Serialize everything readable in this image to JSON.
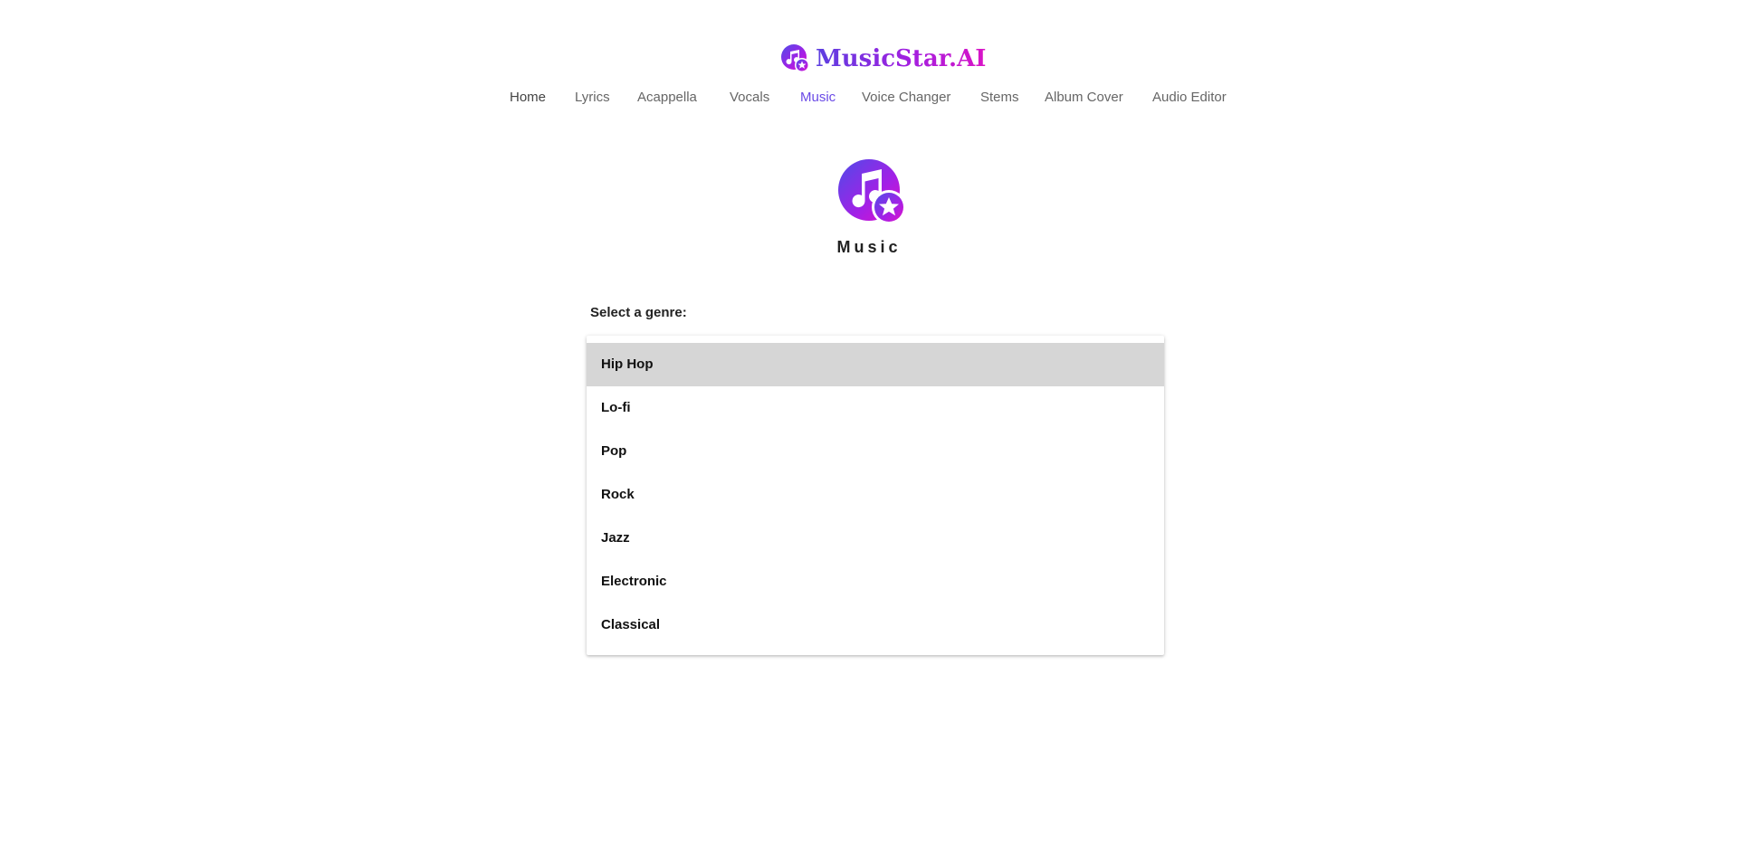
{
  "brand": {
    "name": "MusicStar.AI",
    "colors": {
      "gradient_start": "#5b3fe0",
      "gradient_end": "#d914c6",
      "nav_active": "#6a4ae6"
    },
    "icon": "music-note-star-icon"
  },
  "nav": {
    "items": [
      {
        "label": "Home"
      },
      {
        "label": "Lyrics"
      },
      {
        "label": "Acappella"
      },
      {
        "label": "Vocals"
      },
      {
        "label": "Music"
      },
      {
        "label": "Voice Changer"
      },
      {
        "label": "Stems"
      },
      {
        "label": "Album Cover"
      },
      {
        "label": "Audio Editor"
      }
    ],
    "active": "Music"
  },
  "hero": {
    "icon": "music-note-star-icon",
    "title": "Music"
  },
  "genre": {
    "label": "Select a genre:",
    "selected": "Hip Hop",
    "options": [
      "Hip Hop",
      "Lo-fi",
      "Pop",
      "Rock",
      "Jazz",
      "Electronic",
      "Classical"
    ]
  }
}
